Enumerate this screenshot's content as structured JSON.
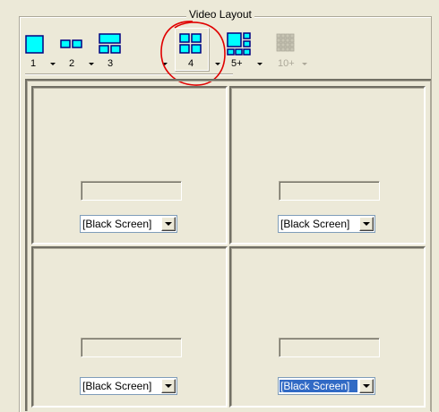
{
  "group": {
    "title": "Video Layout"
  },
  "toolbar": {
    "layouts": [
      {
        "label": "1",
        "icon": "single-screen-layout-icon",
        "enabled": true
      },
      {
        "label": "2",
        "icon": "two-screen-layout-icon",
        "enabled": true
      },
      {
        "label": "3",
        "icon": "three-screen-layout-icon",
        "enabled": true
      },
      {
        "label": "4",
        "icon": "four-screen-layout-icon",
        "enabled": true,
        "pressed": true
      },
      {
        "label": "5+",
        "icon": "five-plus-layout-icon",
        "enabled": true
      },
      {
        "label": "10+",
        "icon": "ten-plus-layout-icon",
        "enabled": false
      }
    ]
  },
  "cells": [
    {
      "label_value": "",
      "source": "[Black Screen]",
      "selected": false
    },
    {
      "label_value": "",
      "source": "[Black Screen]",
      "selected": false
    },
    {
      "label_value": "",
      "source": "[Black Screen]",
      "selected": false
    },
    {
      "label_value": "",
      "source": "[Black Screen]",
      "selected": true
    }
  ],
  "colors": {
    "background": "#ece9d8",
    "icon_fill": "#00ffff",
    "icon_border": "#000080",
    "selection": "#316ac5",
    "annotation": "#e00000",
    "disabled": "#aca899"
  }
}
